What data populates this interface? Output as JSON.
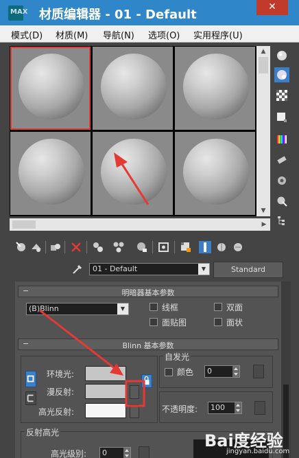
{
  "window": {
    "title": "材质编辑器 - 01 - Default",
    "close_glyph": "✕",
    "app_icon_text": "MAX"
  },
  "menu": [
    "模式(D)",
    "材质(M)",
    "导航(N)",
    "选项(O)",
    "实用程序(U)"
  ],
  "material": {
    "name": "01 - Default",
    "type_button": "Standard"
  },
  "shader_rollout": {
    "title": "明暗器基本参数",
    "shader": "(B)Blinn",
    "options": [
      "线框",
      "双面",
      "面贴图",
      "面状"
    ]
  },
  "blinn_rollout": {
    "title": "Blinn 基本参数",
    "ambient_label": "环境光:",
    "diffuse_label": "漫反射:",
    "specular_label": "高光反射:",
    "self_illum_title": "自发光",
    "color_label": "颜色",
    "self_illum_value": "0",
    "opacity_label": "不透明度:",
    "opacity_value": "100",
    "spec_highlights_title": "反射高光",
    "spec_level_label": "高光级别:",
    "spec_level_value": "0"
  },
  "watermark": {
    "logo": "Bai度经验",
    "url": "jingyan.baidu.com"
  },
  "colors": {
    "title_bar": "#2f86c8",
    "annotation": "#e53935",
    "panel": "#535353"
  }
}
